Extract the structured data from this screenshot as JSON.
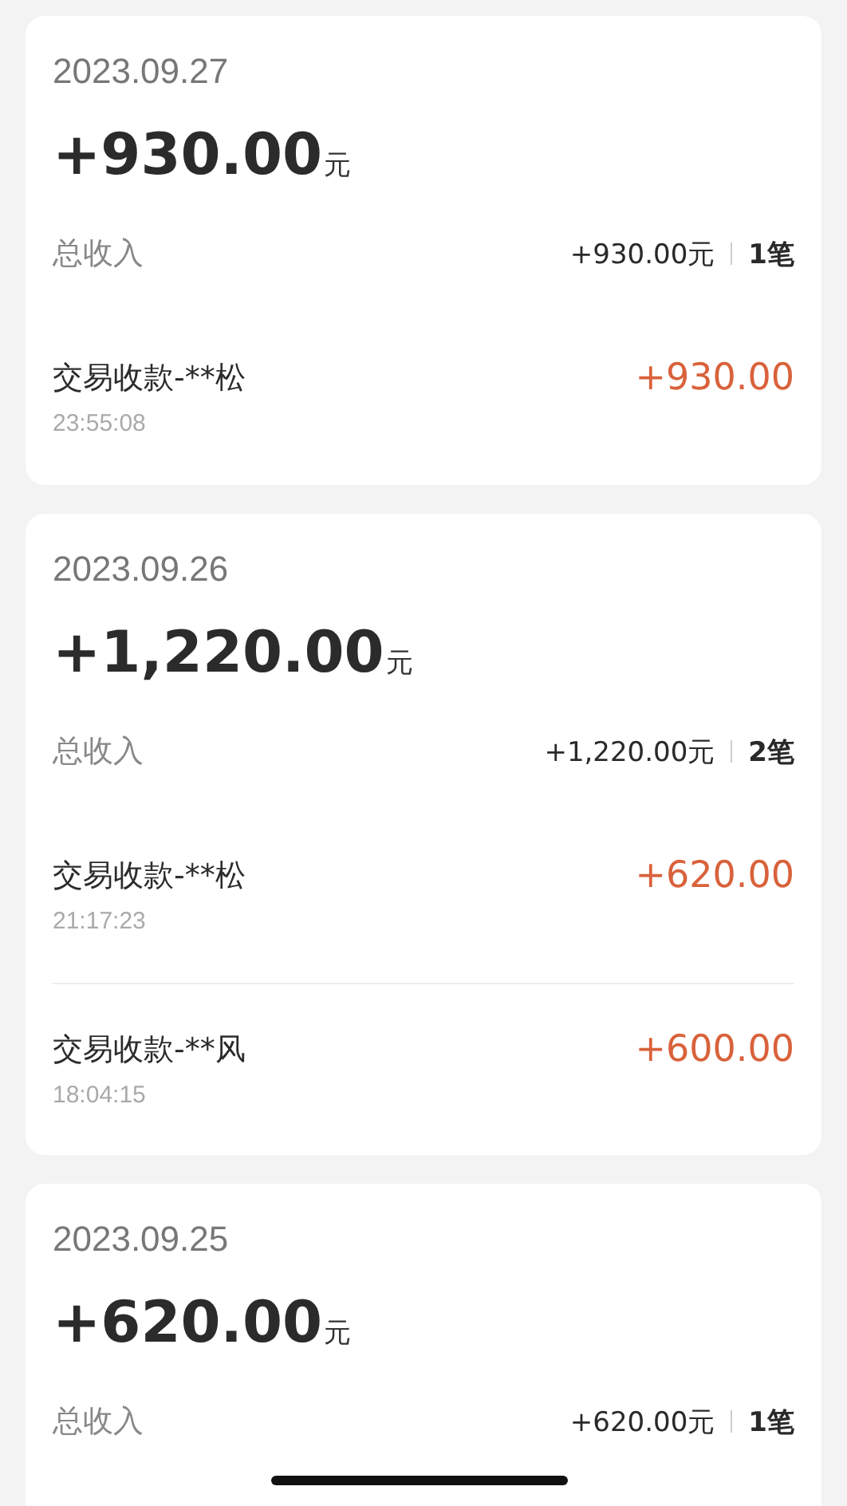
{
  "days": [
    {
      "date": "2023.09.27",
      "total": "+930.00",
      "unit": "元",
      "summary_label": "总收入",
      "summary_amount": "+930.00元",
      "count": "1笔",
      "transactions": [
        {
          "title": "交易收款-**松",
          "time": "23:55:08",
          "amount": "+930.00"
        }
      ]
    },
    {
      "date": "2023.09.26",
      "total": "+1,220.00",
      "unit": "元",
      "summary_label": "总收入",
      "summary_amount": "+1,220.00元",
      "count": "2笔",
      "transactions": [
        {
          "title": "交易收款-**松",
          "time": "21:17:23",
          "amount": "+620.00"
        },
        {
          "title": "交易收款-**风",
          "time": "18:04:15",
          "amount": "+600.00"
        }
      ]
    },
    {
      "date": "2023.09.25",
      "total": "+620.00",
      "unit": "元",
      "summary_label": "总收入",
      "summary_amount": "+620.00元",
      "count": "1笔"
    }
  ]
}
